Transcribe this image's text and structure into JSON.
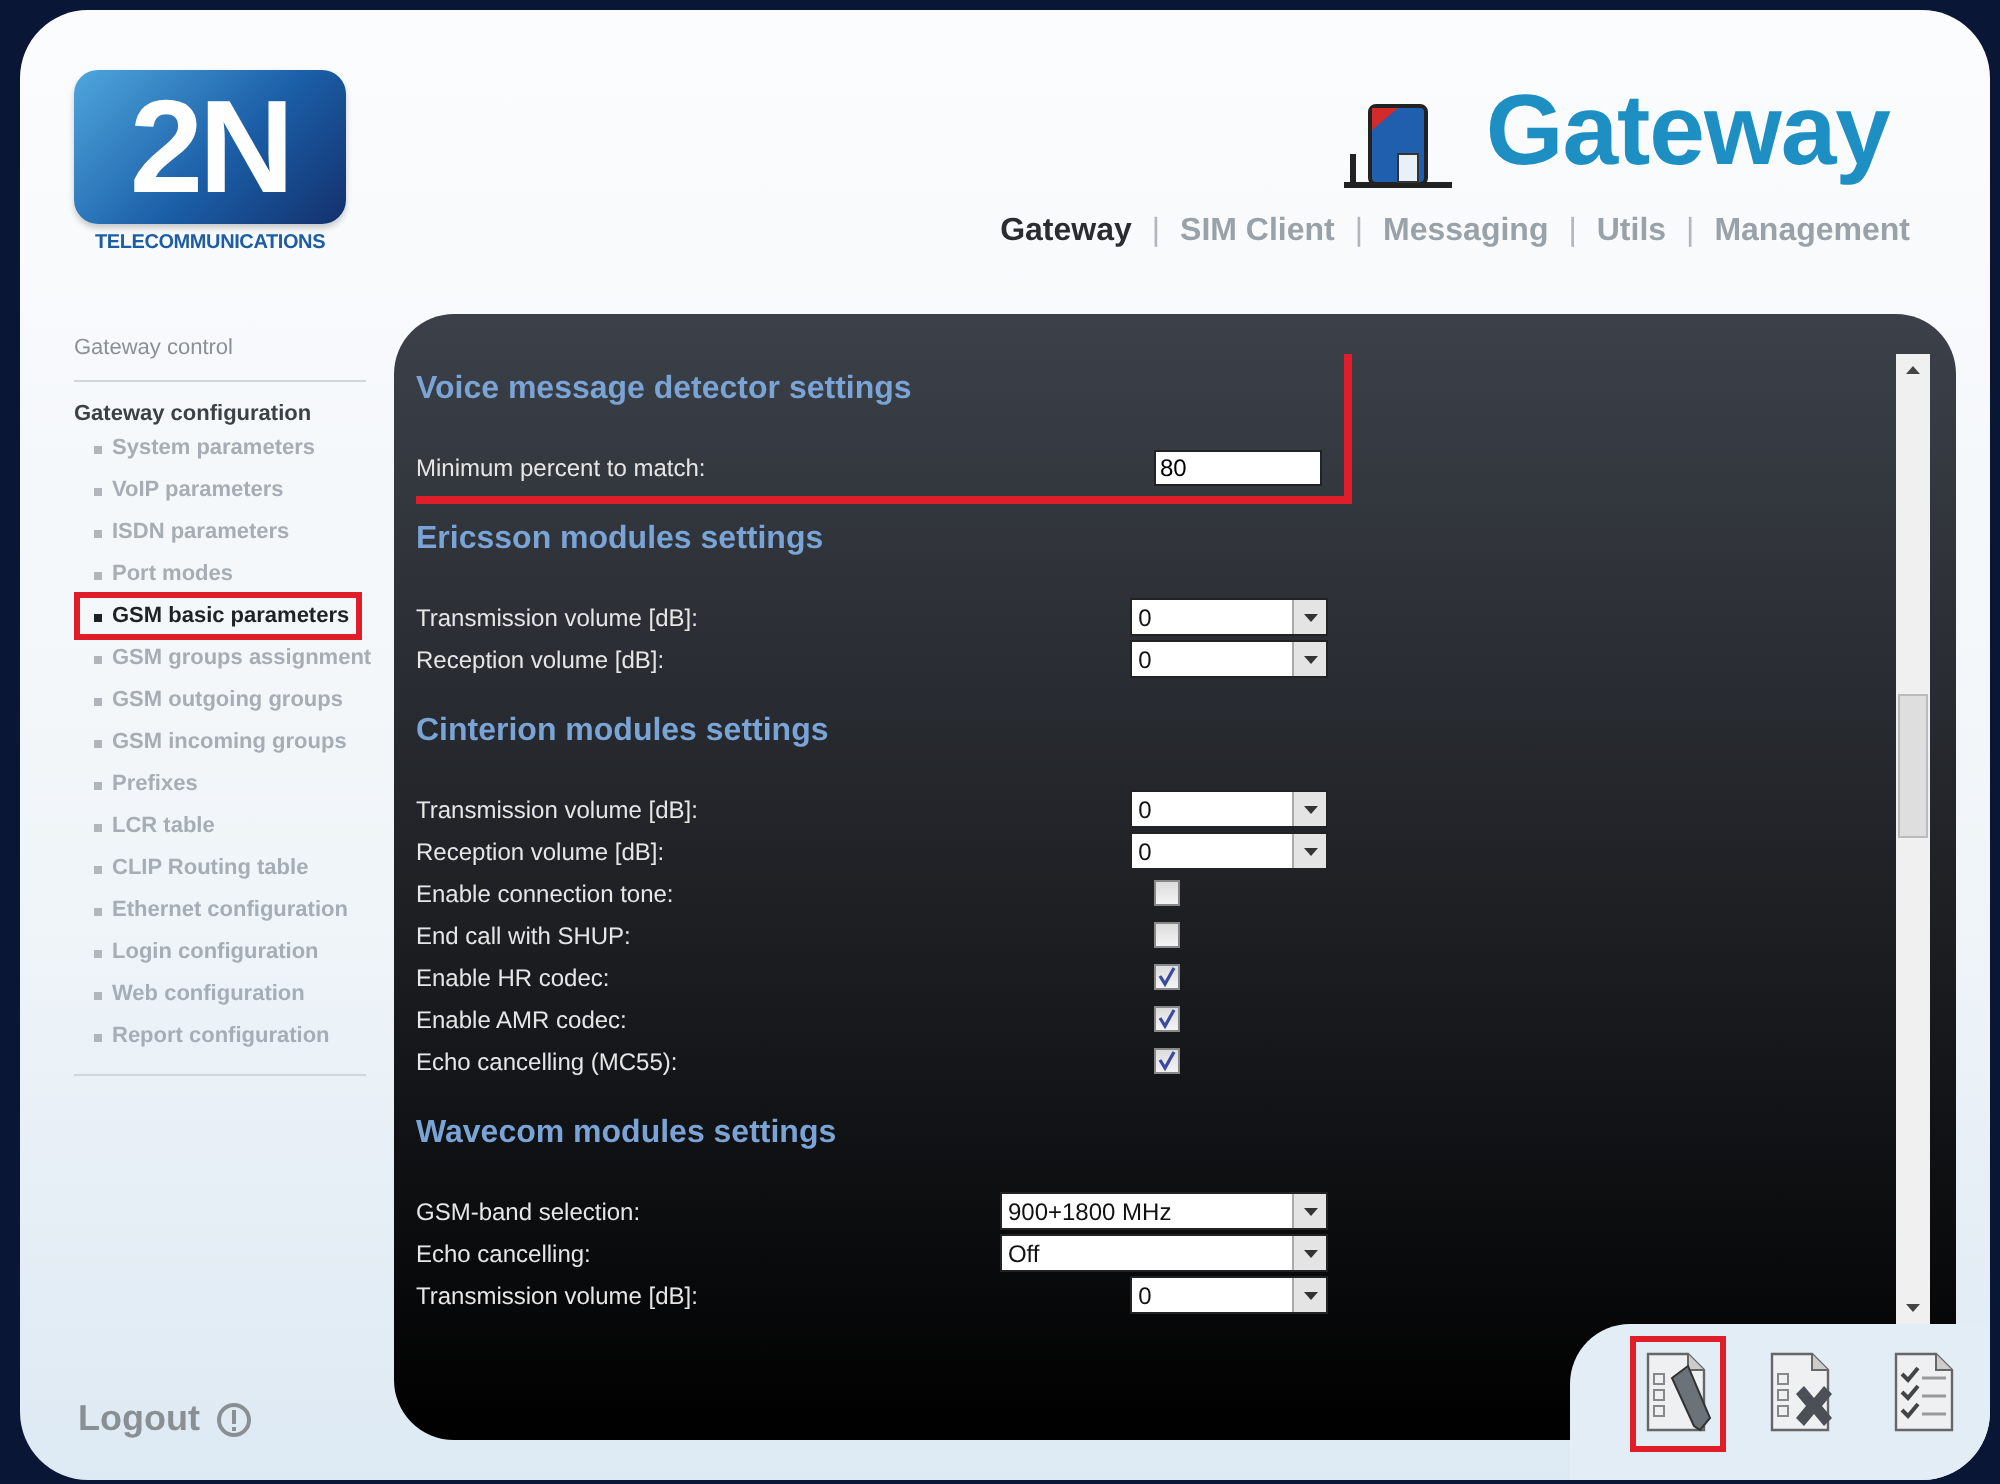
{
  "logo": {
    "mark": "2N",
    "tagline": "TELECOMMUNICATIONS"
  },
  "product": {
    "title": "Gateway"
  },
  "nav_separator": "|",
  "nav": [
    {
      "label": "Gateway",
      "selected": true
    },
    {
      "label": "SIM Client",
      "selected": false
    },
    {
      "label": "Messaging",
      "selected": false
    },
    {
      "label": "Utils",
      "selected": false
    },
    {
      "label": "Management",
      "selected": false
    }
  ],
  "sidebar": {
    "top_link": "Gateway control",
    "group": "Gateway configuration",
    "items": [
      {
        "label": "System parameters",
        "selected": false
      },
      {
        "label": "VoIP parameters",
        "selected": false
      },
      {
        "label": "ISDN parameters",
        "selected": false
      },
      {
        "label": "Port modes",
        "selected": false
      },
      {
        "label": "GSM basic parameters",
        "selected": true
      },
      {
        "label": "GSM groups assignment",
        "selected": false
      },
      {
        "label": "GSM outgoing groups",
        "selected": false
      },
      {
        "label": "GSM incoming groups",
        "selected": false
      },
      {
        "label": "Prefixes",
        "selected": false
      },
      {
        "label": "LCR table",
        "selected": false
      },
      {
        "label": "CLIP Routing table",
        "selected": false
      },
      {
        "label": "Ethernet configuration",
        "selected": false
      },
      {
        "label": "Login configuration",
        "selected": false
      },
      {
        "label": "Web configuration",
        "selected": false
      },
      {
        "label": "Report configuration",
        "selected": false
      }
    ],
    "logout": "Logout"
  },
  "sections": [
    {
      "title": "Voice message detector settings",
      "highlighted": true,
      "rows": [
        {
          "label": "Minimum percent to match:",
          "kind": "text",
          "value": "80"
        }
      ]
    },
    {
      "title": "Ericsson modules settings",
      "highlighted": false,
      "rows": [
        {
          "label": "Transmission volume [dB]:",
          "kind": "select",
          "value": "0"
        },
        {
          "label": "Reception volume [dB]:",
          "kind": "select",
          "value": "0"
        }
      ]
    },
    {
      "title": "Cinterion modules settings",
      "highlighted": false,
      "rows": [
        {
          "label": "Transmission volume [dB]:",
          "kind": "select",
          "value": "0"
        },
        {
          "label": "Reception volume [dB]:",
          "kind": "select",
          "value": "0"
        },
        {
          "label": "Enable connection tone:",
          "kind": "checkbox",
          "checked": false
        },
        {
          "label": "End call with SHUP:",
          "kind": "checkbox",
          "checked": false
        },
        {
          "label": "Enable HR codec:",
          "kind": "checkbox",
          "checked": true
        },
        {
          "label": "Enable AMR codec:",
          "kind": "checkbox",
          "checked": true
        },
        {
          "label": "Echo cancelling (MC55):",
          "kind": "checkbox",
          "checked": true
        }
      ]
    },
    {
      "title": "Wavecom modules settings",
      "highlighted": false,
      "rows": [
        {
          "label": "GSM-band selection:",
          "kind": "wide-select",
          "value": "900+1800 MHz"
        },
        {
          "label": "Echo cancelling:",
          "kind": "wide-select",
          "value": "Off"
        },
        {
          "label": "Transmission volume [dB]:",
          "kind": "select",
          "value": "0"
        }
      ]
    }
  ],
  "toolbar": [
    {
      "kind": "edit",
      "highlighted": true
    },
    {
      "kind": "delete",
      "highlighted": false
    },
    {
      "kind": "check",
      "highlighted": false
    }
  ]
}
